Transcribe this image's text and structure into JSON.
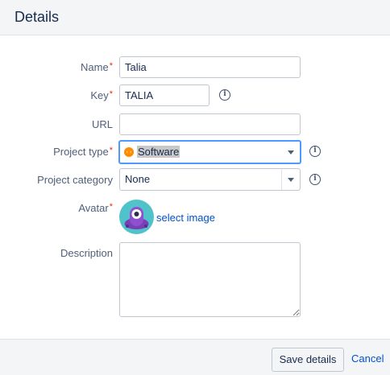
{
  "dialog": {
    "title": "Details"
  },
  "form": {
    "name": {
      "label": "Name",
      "required_mark": "*",
      "value": "Talia"
    },
    "key": {
      "label": "Key",
      "required_mark": "*",
      "value": "TALIA"
    },
    "url": {
      "label": "URL",
      "value": ""
    },
    "project_type": {
      "label": "Project type",
      "required_mark": "*",
      "value": "Software",
      "icon": "software-icon"
    },
    "project_category": {
      "label": "Project category",
      "value": "None"
    },
    "avatar": {
      "label": "Avatar",
      "required_mark": "*",
      "link": "select image"
    },
    "description": {
      "label": "Description",
      "value": ""
    }
  },
  "footer": {
    "save_label": "Save details",
    "cancel_label": "Cancel"
  },
  "colors": {
    "link": "#0052cc",
    "focus": "#4c9aff",
    "required": "#de350b"
  }
}
